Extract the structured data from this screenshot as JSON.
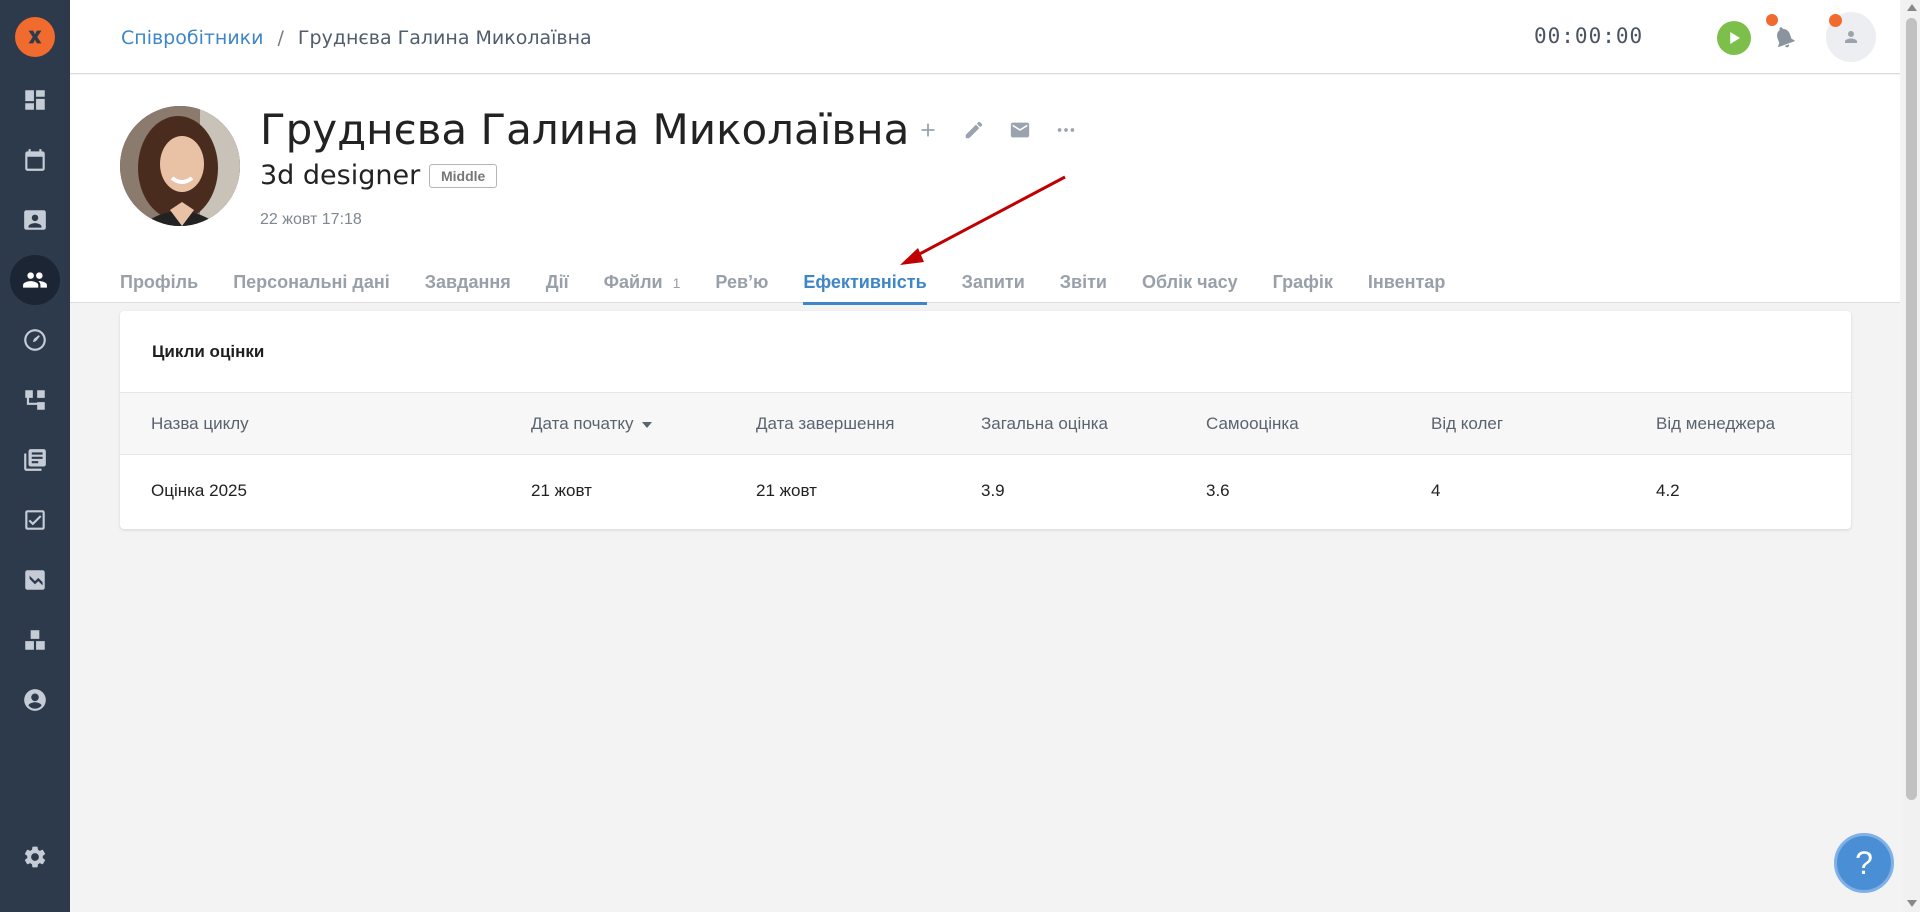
{
  "breadcrumb": {
    "parent": "Співробітники",
    "separator": "/",
    "current": "Груднєва Галина Миколаївна"
  },
  "timer": {
    "value": "00:00:00"
  },
  "profile": {
    "name": "Груднєва Галина Миколаївна",
    "position": "3d designer",
    "level": "Middle",
    "date": "22 жовт 17:18"
  },
  "tabs": [
    {
      "label": "Профіль"
    },
    {
      "label": "Персональні дані"
    },
    {
      "label": "Завдання"
    },
    {
      "label": "Дії"
    },
    {
      "label": "Файли",
      "count": "1"
    },
    {
      "label": "Рев’ю"
    },
    {
      "label": "Ефективність",
      "active": true
    },
    {
      "label": "Запити"
    },
    {
      "label": "Звіти"
    },
    {
      "label": "Облік часу"
    },
    {
      "label": "Графік"
    },
    {
      "label": "Інвентар"
    }
  ],
  "card": {
    "title": "Цикли оцінки",
    "columns": [
      "Назва циклу",
      "Дата початку",
      "Дата завершення",
      "Загальна оцінка",
      "Самооцінка",
      "Від колег",
      "Від менеджера"
    ],
    "rows": [
      [
        "Оцінка 2025",
        "21 жовт",
        "21 жовт",
        "3.9",
        "3.6",
        "4",
        "4.2"
      ]
    ]
  },
  "help": {
    "label": "?"
  },
  "colors": {
    "sidebar": "#2d3a4b",
    "accent": "#3e86c8",
    "brand": "#f26b2e",
    "play": "#7cc04b",
    "annotation": "#c00000"
  },
  "sidebar_icons": [
    "logo-icon",
    "dashboard-icon",
    "calendar-icon",
    "contacts-icon",
    "employees-icon",
    "gauge-icon",
    "workflow-icon",
    "library-icon",
    "tasks-icon",
    "analytics-icon",
    "inventory-icon",
    "account-icon",
    "settings-icon"
  ]
}
